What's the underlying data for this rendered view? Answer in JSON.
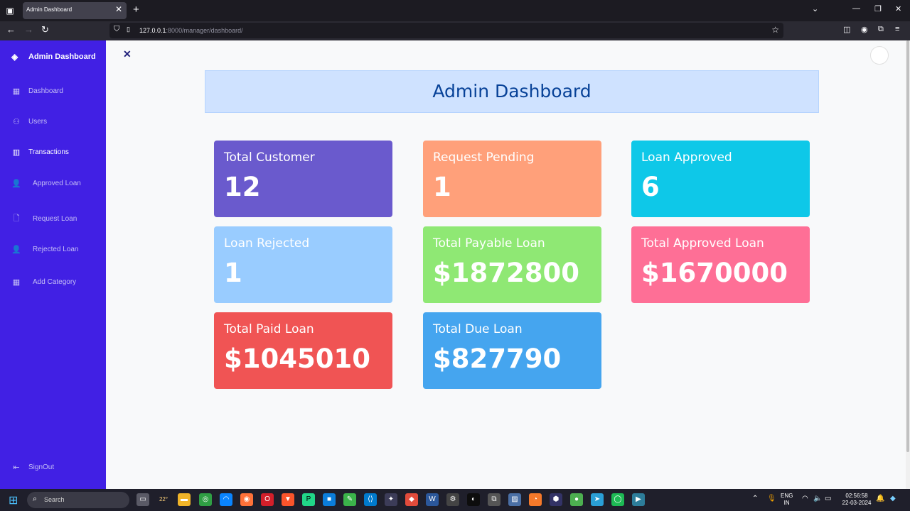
{
  "browser": {
    "tab_title": "Admin Dashboard",
    "url_host": "127.0.0.1",
    "url_rest": ":8000/manager/dashboard/"
  },
  "sidebar": {
    "brand": "Admin Dashboard",
    "items": [
      {
        "label": "Dashboard",
        "icon": "grid-icon"
      },
      {
        "label": "Users",
        "icon": "user-icon"
      },
      {
        "label": "Transactions",
        "icon": "bar-chart-icon"
      },
      {
        "label": "Approved Loan",
        "icon": "user-check-icon"
      },
      {
        "label": "Request Loan",
        "icon": "file-plus-icon"
      },
      {
        "label": "Rejected Loan",
        "icon": "user-x-icon"
      },
      {
        "label": "Add Category",
        "icon": "apps-icon"
      }
    ],
    "signout": "SignOut"
  },
  "main": {
    "title": "Admin Dashboard",
    "cards": [
      {
        "label": "Total Customer",
        "value": "12",
        "color": "#6a5acd"
      },
      {
        "label": "Request Pending",
        "value": "1",
        "color": "#ffa07a"
      },
      {
        "label": "Loan Approved",
        "value": "6",
        "color": "#0ec8e8"
      },
      {
        "label": "Loan Rejected",
        "value": "1",
        "color": "#99ccff"
      },
      {
        "label": "Total Payable Loan",
        "value": "$1872800",
        "color": "#8fe874"
      },
      {
        "label": "Total Approved Loan",
        "value": "$1670000",
        "color": "#fe6f96"
      },
      {
        "label": "Total Paid Loan",
        "value": "$1045010",
        "color": "#f05454"
      },
      {
        "label": "Total Due Loan",
        "value": "$827790",
        "color": "#45a5ef"
      }
    ]
  },
  "taskbar": {
    "search": "Search",
    "weather": "22°",
    "lang_1": "ENG",
    "lang_2": "IN",
    "time": "02:56:58",
    "date": "22-03-2024"
  }
}
